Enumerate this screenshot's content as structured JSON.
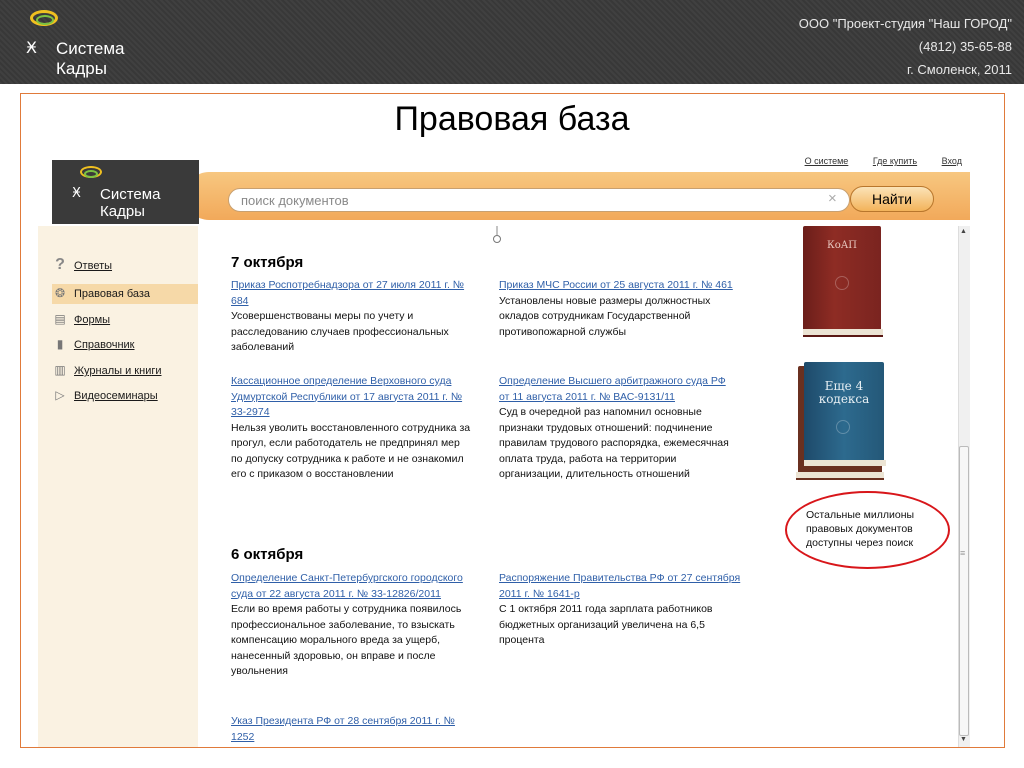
{
  "banner": {
    "logo_line1": "Система",
    "logo_line2": "Кадры",
    "company": "ООО \"Проект-студия \"Наш ГОРОД\"",
    "phone": "(4812) 35-65-88",
    "city": "г. Смоленск, 2011"
  },
  "slide": {
    "title": "Правовая база"
  },
  "app": {
    "logo_line1": "Система",
    "logo_line2": "Кадры",
    "top_links": [
      "О системе",
      "Где купить",
      "Вход"
    ],
    "search": {
      "placeholder": "поиск документов",
      "button": "Найти"
    },
    "sidebar": [
      {
        "label": "Ответы",
        "icon": "question-icon"
      },
      {
        "label": "Правовая база",
        "icon": "emblem-icon"
      },
      {
        "label": "Формы",
        "icon": "form-icon"
      },
      {
        "label": "Справочник",
        "icon": "book-icon"
      },
      {
        "label": "Журналы и книги",
        "icon": "books-icon"
      },
      {
        "label": "Видеосеминары",
        "icon": "video-icon"
      }
    ],
    "sections": [
      {
        "date": "7 октября",
        "docs": [
          {
            "title": "Приказ Роспотребнадзора от 27 июля 2011 г. № 684",
            "desc": "Усовершенствованы меры по учету и расследованию случаев профессиональных заболеваний"
          },
          {
            "title": "Приказ МЧС России от 25 августа 2011 г. № 461",
            "desc": "Установлены новые размеры должностных окладов сотрудникам Государственной противопожарной службы"
          },
          {
            "title": "Кассационное определение Верховного суда Удмуртской Республики от 17 августа 2011 г. № 33-2974",
            "desc": "Нельзя уволить восстановленного сотрудника за прогул, если работодатель не предпринял мер по допуску сотрудника к работе и не ознакомил его с приказом о восстановлении"
          },
          {
            "title": "Определение Высшего арбитражного суда РФ от 11 августа 2011 г. № ВАС-9131/11",
            "desc": "Суд в очередной раз напомнил основные признаки трудовых отношений: подчинение правилам трудового распорядка, ежемесячная оплата труда, работа на территории организации, длительность отношений"
          }
        ]
      },
      {
        "date": "6 октября",
        "docs": [
          {
            "title": "Определение Санкт-Петербургского городского суда от 22 августа 2011 г. № 33-12826/2011",
            "desc": "Если во время работы у сотрудника появилось профессиональное заболевание, то взыскать компенсацию морального вреда за ущерб, нанесенный здоровью, он вправе и после увольнения"
          },
          {
            "title": "Распоряжение Правительства РФ от 27 сентября 2011 г. № 1641-р",
            "desc": "С 1 октября 2011 года зарплата работников бюджетных организаций увеличена на 6,5 процента"
          },
          {
            "title": "Указ Президента РФ от 28 сентября 2011 г. № 1252",
            "desc": ""
          }
        ]
      }
    ],
    "books": {
      "koap": "КоАП",
      "more_line1": "Еще 4",
      "more_line2": "кодекса"
    },
    "promo": "Остальные миллионы правовых документов доступны через поиск"
  }
}
